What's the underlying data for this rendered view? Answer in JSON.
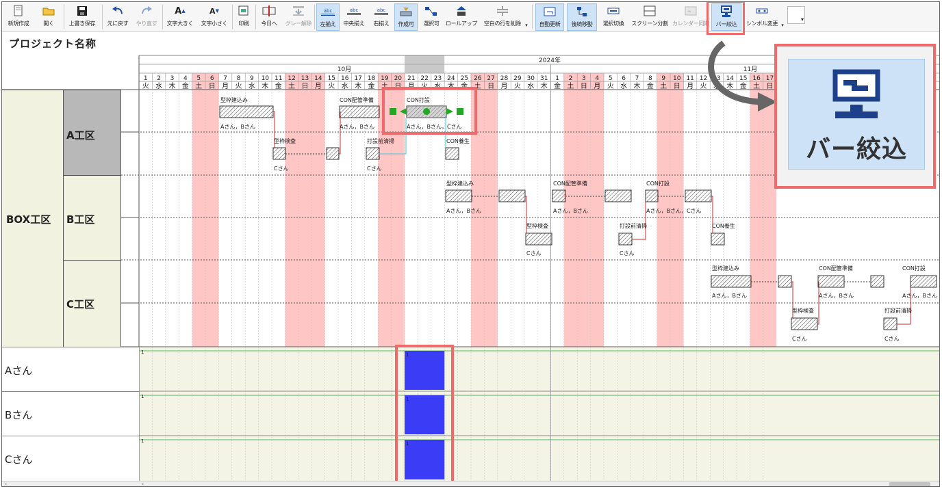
{
  "toolbar": {
    "items": [
      {
        "label": "新規作成",
        "icon": "new-file-icon"
      },
      {
        "label": "開く",
        "icon": "open-folder-icon"
      },
      {
        "label": "上書き保存",
        "icon": "save-icon"
      },
      {
        "label": "元に戻す",
        "icon": "undo-icon"
      },
      {
        "label": "やり直す",
        "icon": "redo-icon"
      },
      {
        "label": "文字大きく",
        "icon": "font-bigger-icon"
      },
      {
        "label": "文字小さく",
        "icon": "font-smaller-icon"
      },
      {
        "label": "印刷",
        "icon": "print-icon"
      },
      {
        "label": "今日へ",
        "icon": "today-icon"
      },
      {
        "label": "グレー解除",
        "icon": "gray-clear-icon"
      },
      {
        "label": "左揃え",
        "icon": "align-left-icon"
      },
      {
        "label": "中央揃え",
        "icon": "align-center-icon"
      },
      {
        "label": "右揃え",
        "icon": "align-right-icon"
      },
      {
        "label": "作成可",
        "icon": "create-enable-icon"
      },
      {
        "label": "選択可",
        "icon": "select-enable-icon"
      },
      {
        "label": "ロールアップ",
        "icon": "rollup-icon"
      },
      {
        "label": "空白の行を削除",
        "icon": "delete-blank-rows-icon"
      },
      {
        "label": "自動更新",
        "icon": "auto-update-icon"
      },
      {
        "label": "後続移動",
        "icon": "successor-move-icon"
      },
      {
        "label": "選択切換",
        "icon": "selection-toggle-icon"
      },
      {
        "label": "スクリーン分割",
        "icon": "screen-split-icon"
      },
      {
        "label": "カレンダー同期",
        "icon": "calendar-sync-icon"
      },
      {
        "label": "バー絞込",
        "icon": "bar-filter-icon"
      },
      {
        "label": "シンボル変更",
        "icon": "symbol-change-icon"
      }
    ],
    "dropdown_caret": "▾"
  },
  "project_title": "プロジェクト名称",
  "calendar": {
    "year_label": "2024年",
    "month_oct": "10月",
    "month_nov": "11月",
    "days": [
      "1",
      "2",
      "3",
      "4",
      "5",
      "6",
      "7",
      "8",
      "9",
      "10",
      "11",
      "12",
      "13",
      "14",
      "15",
      "16",
      "17",
      "18",
      "19",
      "20",
      "21",
      "22",
      "23",
      "24",
      "25",
      "26",
      "27",
      "28",
      "29",
      "30",
      "31",
      "1",
      "2",
      "3",
      "4",
      "5",
      "6",
      "7",
      "8",
      "9",
      "10",
      "11",
      "12",
      "13",
      "14",
      "15",
      "16",
      "17"
    ],
    "weekdays": [
      "火",
      "水",
      "木",
      "金",
      "土",
      "日",
      "月",
      "火",
      "水",
      "木",
      "金",
      "土",
      "日",
      "月",
      "火",
      "水",
      "木",
      "金",
      "土",
      "日",
      "月",
      "火",
      "水",
      "木",
      "金",
      "土",
      "日",
      "月",
      "火",
      "水",
      "木",
      "金",
      "土",
      "日",
      "月",
      "火",
      "水",
      "木",
      "金",
      "土",
      "日",
      "月",
      "火",
      "水",
      "木",
      "金",
      "土",
      "日"
    ],
    "holidays": [
      4,
      5,
      11,
      12,
      13,
      18,
      19,
      25,
      26,
      32,
      33,
      34,
      39,
      40,
      46,
      47
    ],
    "selected_day_index": 20
  },
  "worksite": {
    "label": "BOX工区"
  },
  "areas": [
    {
      "label": "A工区"
    },
    {
      "label": "B工区"
    },
    {
      "label": "C工区"
    }
  ],
  "tasks": {
    "a_frame": "型枠建込み",
    "a_frame_who": "Aさん，Bさん",
    "a_inspect": "型枠検査",
    "a_inspect_who": "Cさん",
    "a_con_prep": "CON配管準備",
    "a_con_prep_who": "Aさん，Bさん",
    "a_clean": "打設前清掃",
    "a_clean_who": "Cさん",
    "a_pour": "CON打設",
    "a_pour_who": "Aさん，Bさん，Cさん",
    "a_cure": "CON養生",
    "b_frame": "型枠建込み",
    "b_frame_who": "Aさん，Bさん",
    "b_inspect": "型枠検査",
    "b_inspect_who": "Cさん",
    "b_con_prep": "CON配管準備",
    "b_con_prep_who": "Aさん，Bさん",
    "b_clean": "打設前清掃",
    "b_clean_who": "Cさん",
    "b_pour": "CON打設",
    "b_pour_who": "Aさん，Bさん，Cさん",
    "b_cure": "CON養生",
    "c_frame": "型枠建込み",
    "c_frame_who": "Aさん，Bさん",
    "c_inspect": "型枠検査",
    "c_inspect_who": "Cさん",
    "c_con_prep": "CON配管準備",
    "c_con_prep_who": "Aさん，Bさん",
    "c_clean": "打設前清掃",
    "c_clean_who": "Cさん",
    "c_pour": "CON打設",
    "c_pour_who": "Aさん，Bさん"
  },
  "resources": [
    {
      "label": "Aさん",
      "count": "1"
    },
    {
      "label": "Bさん",
      "count": "1"
    },
    {
      "label": "Cさん",
      "count": "1"
    }
  ],
  "callout": {
    "label": "バー絞込"
  },
  "colors": {
    "holiday": "#ffc6c6",
    "selected_col": "#c9c9c9",
    "load_bar": "#3a3df5",
    "milestone": "#22a822",
    "link": "#d12a2a",
    "highlight": "#ef6a6a",
    "resource_bg": "#f4f4e6"
  }
}
